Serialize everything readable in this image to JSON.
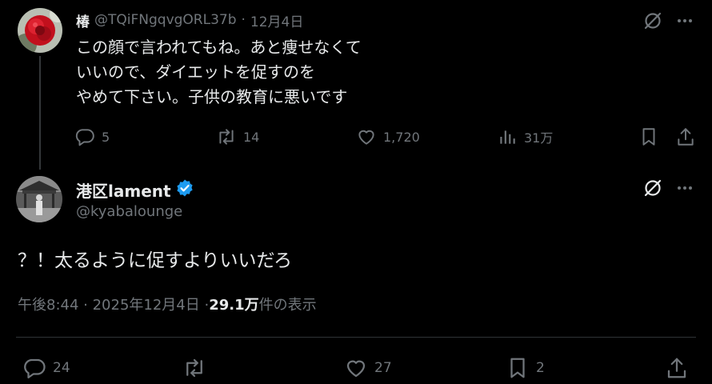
{
  "colors": {
    "background": "#000000",
    "text": "#e7e9ea",
    "muted": "#71767b",
    "verified": "#1d9bf0",
    "divider": "#2f3336"
  },
  "reply_tweet": {
    "display_name": "椿",
    "handle": "@TQiFNgqvgORL37b",
    "separator": "·",
    "date": "12月4日",
    "text_lines": [
      "この顔で言われてもね。あと痩せなくて",
      "いいので、ダイエットを促すのを",
      "やめて下さい。子供の教育に悪いです"
    ],
    "actions": {
      "replies": "5",
      "reposts": "14",
      "likes": "1,720",
      "views": "31万"
    }
  },
  "main_tweet": {
    "display_name": "港区lament",
    "handle": "@kyabalounge",
    "text": "？！太るように促すよりいいだろ",
    "time": "午後8:44 · 2025年12月4日 · ",
    "views_count": "29.1万",
    "views_label": " 件の表示",
    "actions": {
      "replies": "24",
      "likes": "27",
      "bookmarks": "2"
    }
  }
}
